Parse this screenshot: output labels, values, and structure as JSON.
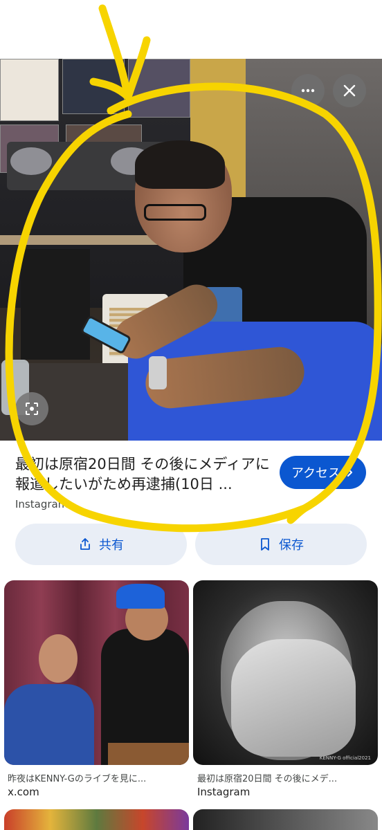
{
  "viewer": {
    "more_icon": "more-horizontal-icon",
    "close_icon": "close-icon",
    "lens_icon": "lens-search-icon"
  },
  "result": {
    "title": "最初は原宿20日間 その後にメディアに報道したいがため再逮捕(10日 ...",
    "source": "Instagram",
    "access_label": "アクセス",
    "share_label": "共有",
    "save_label": "保存"
  },
  "grid": [
    {
      "caption": "昨夜はKENNY-Gのライブを見に...",
      "source": "x.com"
    },
    {
      "caption": "最初は原宿20日間 その後にメデ...",
      "source": "Instagram",
      "watermark": "KENNY-G official2021"
    }
  ],
  "colors": {
    "accent": "#0b57d0",
    "annotation": "#f7d400",
    "action_bg": "#e9eef6"
  }
}
